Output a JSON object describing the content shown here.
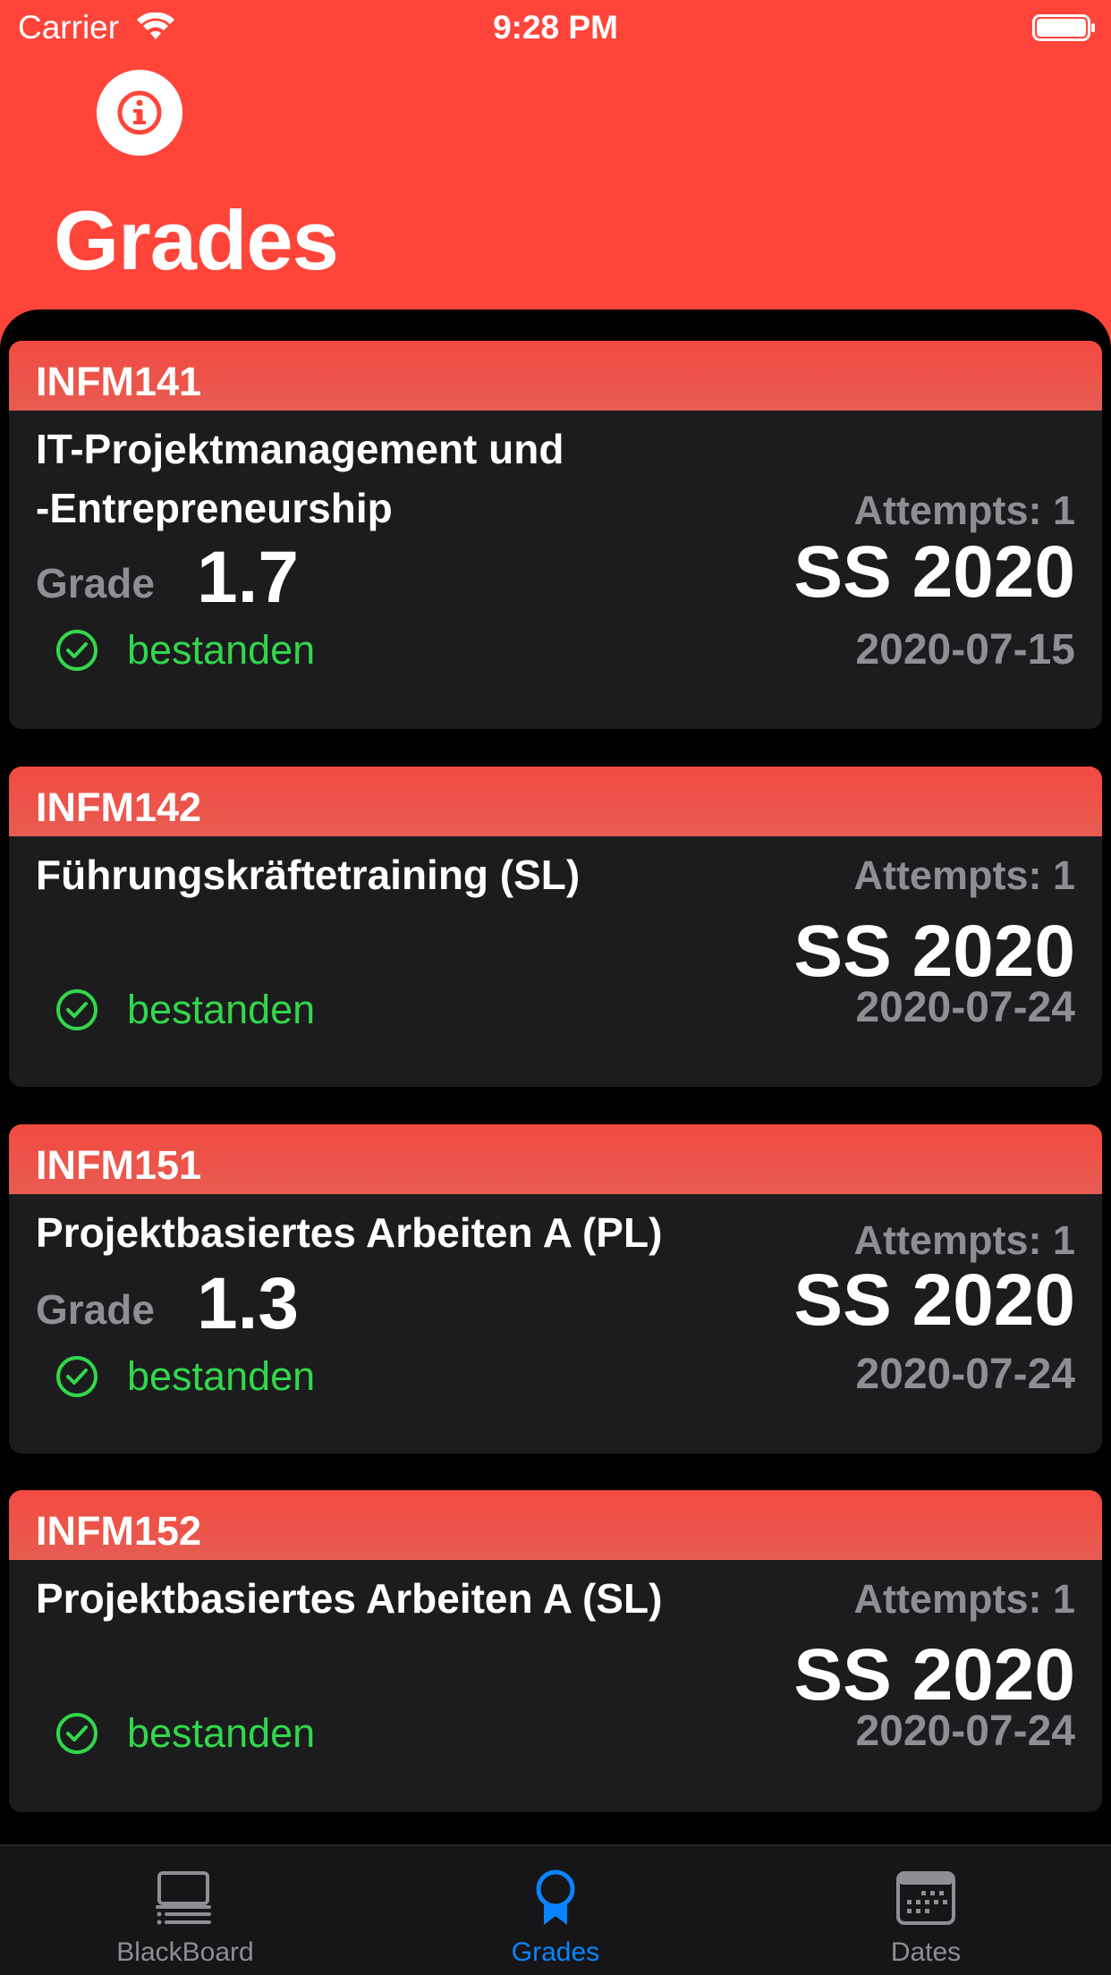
{
  "status_bar": {
    "carrier": "Carrier",
    "time": "9:28 PM"
  },
  "header": {
    "title": "Grades",
    "info_icon": "info-circle-icon"
  },
  "labels": {
    "grade": "Grade"
  },
  "cards": [
    {
      "code": "INFM141",
      "title_line1": "IT-Projektmanagement und",
      "title_line2": "-Entrepreneurship",
      "attempts": "Attempts: 1",
      "grade": "1.7",
      "semester": "SS 2020",
      "date": "2020-07-15",
      "status": "bestanden"
    },
    {
      "code": "INFM142",
      "title_line1": "Führungskräftetraining (SL)",
      "attempts": "Attempts: 1",
      "semester": "SS 2020",
      "date": "2020-07-24",
      "status": "bestanden"
    },
    {
      "code": "INFM151",
      "title_line1": "Projektbasiertes Arbeiten A (PL)",
      "attempts": "Attempts: 1",
      "grade": "1.3",
      "semester": "SS 2020",
      "date": "2020-07-24",
      "status": "bestanden"
    },
    {
      "code": "INFM152",
      "title_line1": "Projektbasiertes Arbeiten A (SL)",
      "attempts": "Attempts: 1",
      "semester": "SS 2020",
      "date": "2020-07-24",
      "status": "bestanden"
    }
  ],
  "tabbar": {
    "tabs": [
      {
        "label": "BlackBoard",
        "icon": "blackboard-icon"
      },
      {
        "label": "Grades",
        "icon": "ribbon-icon",
        "active": true
      },
      {
        "label": "Dates",
        "icon": "calendar-icon"
      }
    ]
  },
  "colors": {
    "accent": "#FF453A",
    "card_header": "#E85C52",
    "card_bg": "#1C1C1E",
    "pass_green": "#32D74B",
    "active_tab": "#0A84FF",
    "secondary_text": "#8E8E93"
  }
}
